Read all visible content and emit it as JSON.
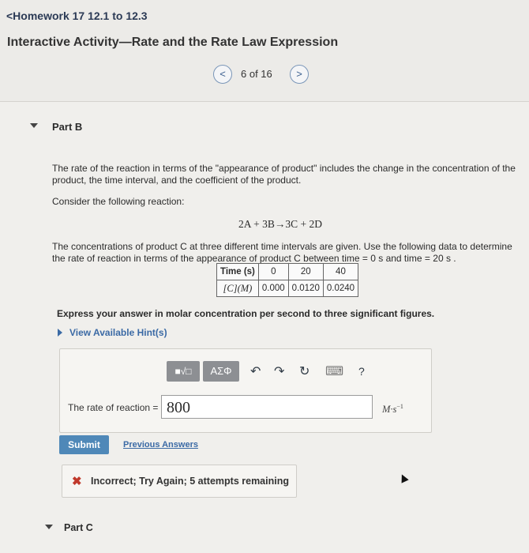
{
  "header": {
    "back_link": "<Homework 17 12.1 to 12.3",
    "title": "Interactive Activity—Rate and the Rate Law Expression"
  },
  "pager": {
    "prev": "<",
    "count": "6 of 16",
    "next": ">"
  },
  "part_b": {
    "label": "Part B",
    "intro": "The rate of the reaction in terms of the \"appearance of product\" includes the change in the concentration of the product, the time interval, and the coefficient of the product.",
    "consider": "Consider the following reaction:",
    "reaction": "2A + 3B→3C + 2D",
    "data_text": "The concentrations of product C at three different time intervals are given. Use the following data to determine the rate of reaction in terms of the appearance of product C between time = 0 s and time = 20 s .",
    "table": {
      "header_label": "Time (s)",
      "times": [
        "0",
        "20",
        "40"
      ],
      "row_label": "[C](M)",
      "values": [
        "0.000",
        "0.0120",
        "0.0240"
      ]
    },
    "instruction": "Express your answer in molar concentration per second to three significant figures.",
    "hint_link": "View Available Hint(s)",
    "toolbar": {
      "template_label": "■√□",
      "greek_label": "ΑΣΦ",
      "undo_icon": "↶",
      "redo_icon": "↷",
      "reset_icon": "↻",
      "keyboard_icon": "⌨",
      "help_icon": "?"
    },
    "rate_label": "The rate of reaction =",
    "answer_value": "800",
    "units": "M·s",
    "units_exp": "−1",
    "submit": "Submit",
    "previous_answers": "Previous Answers",
    "feedback_icon": "✖",
    "feedback": "Incorrect; Try Again; 5 attempts remaining"
  },
  "part_c": {
    "label": "Part C"
  }
}
